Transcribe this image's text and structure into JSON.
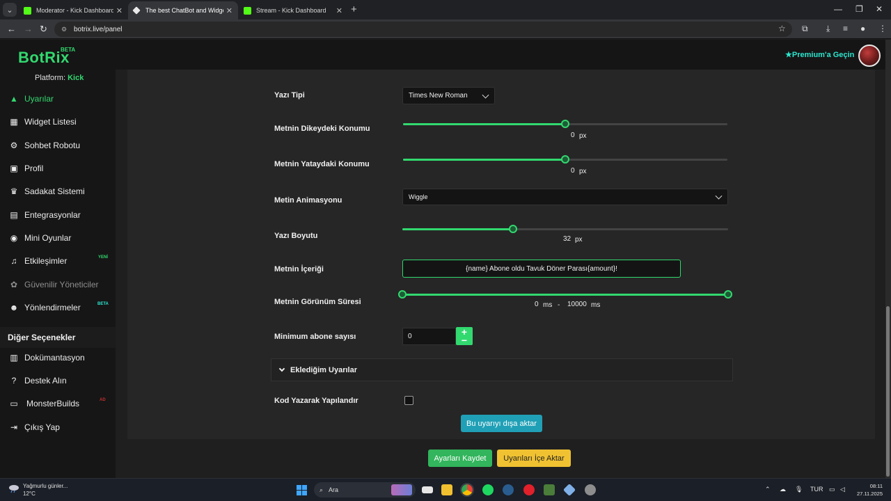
{
  "browser": {
    "tabs": [
      {
        "title": "Moderator - Kick Dashboard",
        "active": false
      },
      {
        "title": "The best ChatBot and Widgets",
        "active": true
      },
      {
        "title": "Stream - Kick Dashboard",
        "active": false
      }
    ],
    "url": "botrix.live/panel"
  },
  "header": {
    "logo": "BotRix",
    "logo_badge": "BETA",
    "premium": "Premium'a Geçin"
  },
  "sidebar": {
    "platform_label": "Platform:",
    "platform_value": "Kick",
    "items": [
      {
        "label": "Uyarılar",
        "icon": "warning-icon",
        "active": true
      },
      {
        "label": "Widget Listesi",
        "icon": "grid-icon"
      },
      {
        "label": "Sohbet Robotu",
        "icon": "robot-icon"
      },
      {
        "label": "Profil",
        "icon": "id-card-icon"
      },
      {
        "label": "Sadakat Sistemi",
        "icon": "trophy-icon"
      },
      {
        "label": "Entegrasyonlar",
        "icon": "plugin-icon"
      },
      {
        "label": "Mini Oyunlar",
        "icon": "gamepad-icon"
      },
      {
        "label": "Etkileşimler",
        "icon": "music-icon",
        "badge": "YENİ"
      },
      {
        "label": "Güvenilir Yöneticiler",
        "icon": "users-icon",
        "dim": true
      },
      {
        "label": "Yönlendirmeler",
        "icon": "user-group-icon",
        "badge": "BETA"
      }
    ],
    "section_title": "Diğer Seçenekler",
    "other_items": [
      {
        "label": "Dokümantasyon",
        "icon": "docs-icon"
      },
      {
        "label": "Destek Alın",
        "icon": "help-icon"
      },
      {
        "label": "MonsterBuilds",
        "icon": "laptop-icon",
        "badge": "AD"
      },
      {
        "label": "Çıkış Yap",
        "icon": "logout-icon"
      }
    ]
  },
  "form": {
    "font": {
      "label": "Yazı Tipi",
      "value": "Times New Roman"
    },
    "vertical": {
      "label": "Metnin Dikeydeki Konumu",
      "value": "0",
      "unit": "px",
      "position": 0.5
    },
    "horizontal": {
      "label": "Metnin Yataydaki Konumu",
      "value": "0",
      "unit": "px",
      "position": 0.5
    },
    "animation": {
      "label": "Metin Animasyonu",
      "value": "Wiggle"
    },
    "size": {
      "label": "Yazı Boyutu",
      "value": "32",
      "unit": "px",
      "position": 0.34
    },
    "content": {
      "label": "Metnin İçeriği",
      "value": "{name} Abone oldu Tavuk Döner Parası{amount}!"
    },
    "duration": {
      "label": "Metnin Görünüm Süresi",
      "min": "0",
      "max": "10000",
      "unit": "ms",
      "sep": "-"
    },
    "min_subs": {
      "label": "Minimum abone sayısı",
      "value": "0"
    },
    "accordion": "Eklediğim Uyarılar",
    "code_config": {
      "label": "Kod Yazarak Yapılandır",
      "checked": false
    },
    "export_btn": "Bu uyarıyı dışa aktar",
    "save_btn": "Ayarları Kaydet",
    "import_btn": "Uyarıları İçe Aktar"
  },
  "taskbar": {
    "weather_title": "Yağmurlu günler...",
    "weather_temp": "12°C",
    "search": "Ara",
    "lang": "TUR",
    "time": "08:11",
    "date": "27.11.2025"
  },
  "colors": {
    "accent": "#32d96f",
    "premium": "#2ce6cf",
    "export": "#20a0b6",
    "import": "#f0c232"
  }
}
